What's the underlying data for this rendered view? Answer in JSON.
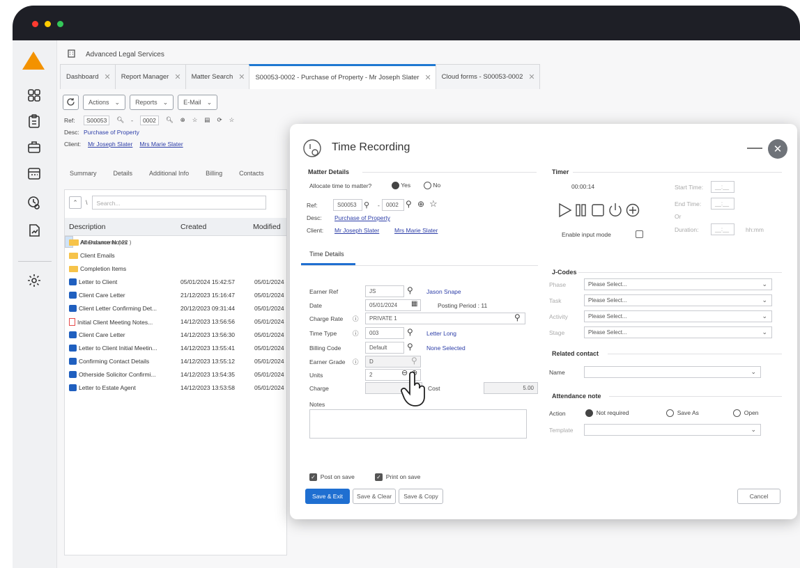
{
  "app": {
    "company": "Advanced Legal Services",
    "tabs": [
      {
        "label": "Dashboard"
      },
      {
        "label": "Report Manager"
      },
      {
        "label": "Matter Search"
      },
      {
        "label": "S00053-0002 - Purchase of Property - Mr Joseph Slater"
      },
      {
        "label": "Cloud forms - S00053-0002"
      }
    ],
    "toolbar": {
      "actions": "Actions",
      "reports": "Reports",
      "email": "E-Mail"
    },
    "ref": {
      "label": "Ref:",
      "matter": "S00053",
      "sep": "-",
      "number": "0002"
    },
    "desc": {
      "label": "Desc:",
      "value": "Purchase of Property"
    },
    "client": {
      "label": "Client:",
      "client1": "Mr Joseph Slater",
      "client2": "Mrs Marie Slater"
    },
    "subtabs": [
      "Summary",
      "Details",
      "Additional Info",
      "Billing",
      "Contacts"
    ],
    "search_placeholder": "Search...",
    "doc_columns": [
      "Description",
      "Created",
      "Modified"
    ],
    "documents": [
      {
        "name": "All Documents ( 22 )",
        "icon": "folder",
        "created": "",
        "modified": "",
        "selected": true
      },
      {
        "name": "Attendance Notes",
        "icon": "folder",
        "created": "",
        "modified": ""
      },
      {
        "name": "Client Emails",
        "icon": "folder",
        "created": "",
        "modified": ""
      },
      {
        "name": "Completion Items",
        "icon": "folder",
        "created": "",
        "modified": ""
      },
      {
        "name": "Letter to Client",
        "icon": "word",
        "created": "05/01/2024 15:42:57",
        "modified": "05/01/2024"
      },
      {
        "name": "Client Care Letter",
        "icon": "word",
        "created": "21/12/2023 15:16:47",
        "modified": "05/01/2024"
      },
      {
        "name": "Client Letter Confirming Det...",
        "icon": "word",
        "created": "20/12/2023 09:31:44",
        "modified": "05/01/2024"
      },
      {
        "name": "Initial Client Meeting Notes...",
        "icon": "pdf",
        "created": "14/12/2023 13:56:56",
        "modified": "05/01/2024"
      },
      {
        "name": "Client Care Letter",
        "icon": "word",
        "created": "14/12/2023 13:56:30",
        "modified": "05/01/2024"
      },
      {
        "name": "Letter to Client Initial Meetin...",
        "icon": "word",
        "created": "14/12/2023 13:55:41",
        "modified": "05/01/2024"
      },
      {
        "name": "Confirming Contact Details",
        "icon": "word",
        "created": "14/12/2023 13:55:12",
        "modified": "05/01/2024"
      },
      {
        "name": "Otherside Solicitor Confirmi...",
        "icon": "word",
        "created": "14/12/2023 13:54:35",
        "modified": "05/01/2024"
      },
      {
        "name": "Letter to Estate Agent",
        "icon": "word",
        "created": "14/12/2023 13:53:58",
        "modified": "05/01/2024"
      }
    ]
  },
  "dialog": {
    "title": "Time Recording",
    "matter_details": {
      "heading": "Matter Details",
      "allocate_label": "Allocate time to matter?",
      "yes": "Yes",
      "no": "No",
      "ref_label": "Ref:",
      "matter": "S00053",
      "sep": "-",
      "number": "0002",
      "desc_label": "Desc:",
      "desc": "Purchase of Property",
      "client_label": "Client:",
      "client1": "Mr Joseph Slater",
      "client2": "Mrs Marie Slater"
    },
    "timer": {
      "heading": "Timer",
      "elapsed": "00:00:14",
      "start_label": "Start Time:",
      "end_label": "End Time:",
      "or": "Or",
      "duration_label": "Duration:",
      "time_placeholder": "__:__",
      "duration_unit": "hh:mm",
      "enable_input": "Enable input mode"
    },
    "time_details_tab": "Time Details",
    "fields": {
      "earner_ref_label": "Earner Ref",
      "earner_ref": "JS",
      "earner_name": "Jason Snape",
      "date_label": "Date",
      "date": "05/01/2024",
      "posting_period": "Posting Period : 11",
      "charge_rate_label": "Charge Rate",
      "charge_rate": "PRIVATE 1",
      "time_type_label": "Time Type",
      "time_type": "003",
      "time_type_name": "Letter Long",
      "billing_code_label": "Billing Code",
      "billing_code": "Default",
      "billing_code_name": "None Selected",
      "earner_grade_label": "Earner Grade",
      "earner_grade": "D",
      "units_label": "Units",
      "units": "2",
      "charge_label": "Charge",
      "charge": "50",
      "cost_label": "Cost",
      "cost": "5.00",
      "notes_label": "Notes"
    },
    "jcodes": {
      "heading": "J-Codes",
      "rows": [
        {
          "label": "Phase",
          "value": "Please Select..."
        },
        {
          "label": "Task",
          "value": "Please Select..."
        },
        {
          "label": "Activity",
          "value": "Please Select..."
        },
        {
          "label": "Stage",
          "value": "Please Select..."
        }
      ]
    },
    "related_contact": {
      "heading": "Related contact",
      "name_label": "Name",
      "name_value": ""
    },
    "attendance_note": {
      "heading": "Attendance note",
      "action_label": "Action",
      "not_required": "Not required",
      "save_as": "Save As",
      "open": "Open",
      "template_label": "Template",
      "template_value": ""
    },
    "post_on_save": "Post on save",
    "print_on_save": "Print on save",
    "buttons": {
      "save_exit": "Save & Exit",
      "save_clear": "Save & Clear",
      "save_copy": "Save & Copy",
      "cancel": "Cancel"
    }
  },
  "colors": {
    "accent": "#1f6fd1",
    "logo": "#f39200",
    "frame": "#1e1f26",
    "link": "#2d3ea8"
  }
}
